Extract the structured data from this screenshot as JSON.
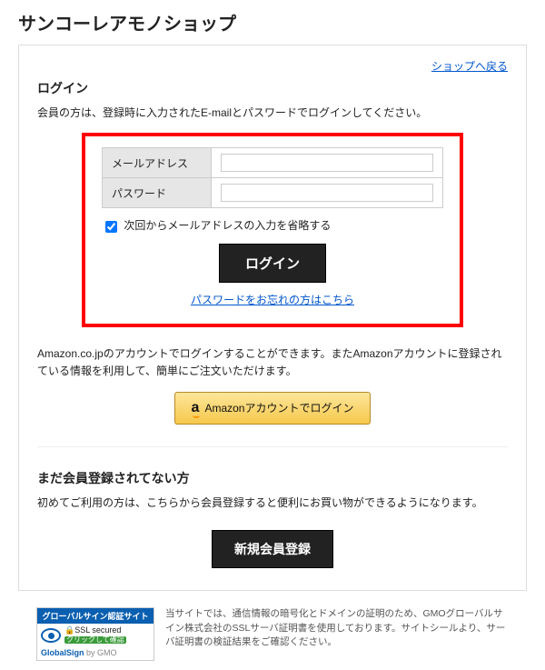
{
  "page": {
    "title": "サンコーレアモノショップ",
    "back_link": "ショップへ戻る"
  },
  "login": {
    "title": "ログイン",
    "description": "会員の方は、登録時に入力されたE-mailとパスワードでログインしてください。",
    "email_label": "メールアドレス",
    "password_label": "パスワード",
    "remember_label": "次回からメールアドレスの入力を省略する",
    "button": "ログイン",
    "forgot": "パスワードをお忘れの方はこちら"
  },
  "amazon": {
    "description": "Amazon.co.jpのアカウントでログインすることができます。またAmazonアカウントに登録されている情報を利用して、簡単にご注文いただけます。",
    "logo": "a",
    "button": "Amazonアカウントでログイン"
  },
  "register": {
    "title": "まだ会員登録されてない方",
    "description": "初めてご利用の方は、こちらから会員登録すると便利にお買い物ができるようになります。",
    "button": "新規会員登録"
  },
  "seal": {
    "top": "グローバルサイン認証サイト",
    "ssl": "SSL secured",
    "click": "クリックして確認",
    "brand": "GlobalSign",
    "gmo": "by GMO"
  },
  "footer": {
    "text": "当サイトでは、通信情報の暗号化とドメインの証明のため、GMOグローバルサイン株式会社のSSLサーバ証明書を使用しております。サイトシールより、サーバ証明書の検証結果をご確認ください。"
  }
}
